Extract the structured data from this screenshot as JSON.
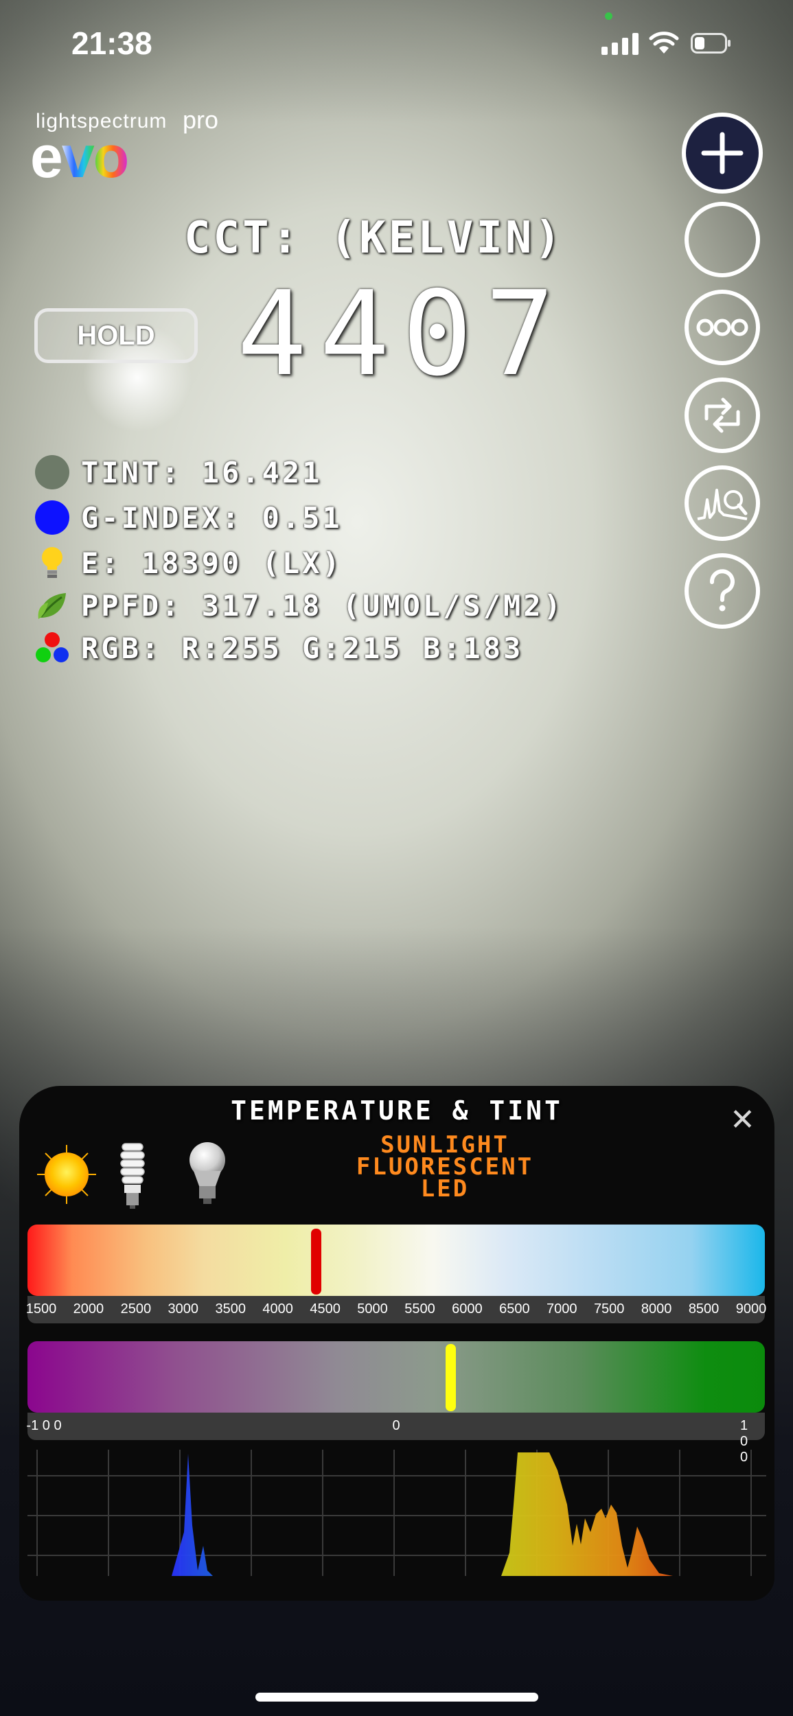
{
  "status_bar": {
    "time": "21:38"
  },
  "logo": {
    "small": "lightspectrum",
    "pro": "pro",
    "big": "evo"
  },
  "cct": {
    "label": "CCT: (KELVIN)",
    "value": "4407"
  },
  "hold_label": "HOLD",
  "metrics": [
    {
      "icon": "tint-color-dot",
      "color": "#6d7a68",
      "text": "TINT: 16.421"
    },
    {
      "icon": "g-index-color-dot",
      "color": "#0d12ff",
      "text": "G-INDEX: 0.51"
    },
    {
      "icon": "lightbulb-icon",
      "text": "E: 18390 (LX)"
    },
    {
      "icon": "leaf-icon",
      "text": "PPFD: 317.18 (UMOL/S/M2)"
    },
    {
      "icon": "rgb-dots-icon",
      "text": "RGB: R:255 G:215 B:183"
    }
  ],
  "side_buttons": [
    "add-icon",
    "circle-icon",
    "more-icon",
    "refresh-icon",
    "spectrum-search-icon",
    "help-icon"
  ],
  "panel": {
    "title": "TEMPERATURE & TINT",
    "legend": [
      "SUNLIGHT",
      "FLUORESCENT",
      "LED"
    ],
    "temperature_scale": [
      "1500",
      "2000",
      "2500",
      "3000",
      "3500",
      "4000",
      "4500",
      "5000",
      "5500",
      "6000",
      "6500",
      "7000",
      "7500",
      "8000",
      "8500",
      "9000"
    ],
    "temperature_marker_kelvin": 4407,
    "tint_scale": {
      "min": "-1 0 0",
      "mid": "0",
      "max": "1 0 0"
    },
    "tint_marker_value": 16.421
  },
  "colors": {
    "accent_orange": "#ff8a1e",
    "fab_primary": "#1d2140"
  }
}
